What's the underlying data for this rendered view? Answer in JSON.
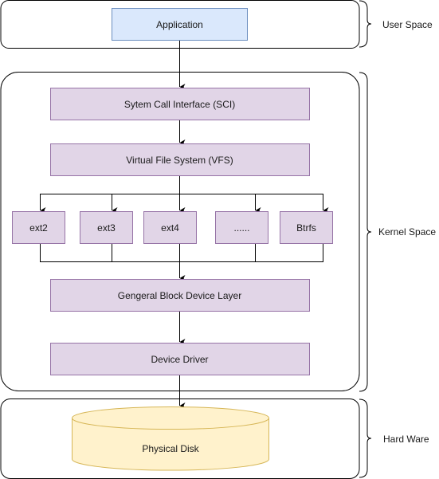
{
  "layers": {
    "user_space": "User Space",
    "kernel_space": "Kernel Space",
    "hardware": "Hard Ware"
  },
  "nodes": {
    "application": "Application",
    "sci": "Sytem Call Interface (SCI)",
    "vfs": "Virtual File System (VFS)",
    "filesystems": [
      "ext2",
      "ext3",
      "ext4",
      "......",
      "Btrfs"
    ],
    "block_layer": "Gengeral Block Device Layer",
    "device_driver": "Device Driver",
    "disk": "Physical Disk"
  },
  "colors": {
    "application_fill": "#dae8fc",
    "application_stroke": "#6c8ebf",
    "kernel_fill": "#e1d5e7",
    "kernel_stroke": "#9673a6",
    "disk_fill": "#fff2cc",
    "disk_stroke": "#d6b656"
  }
}
